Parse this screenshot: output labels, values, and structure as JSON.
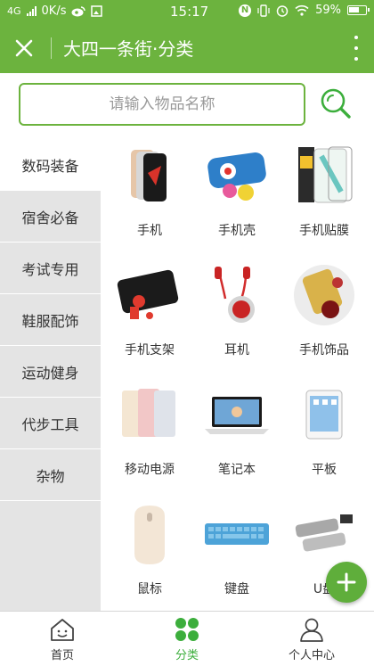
{
  "status_bar": {
    "network": "4G",
    "speed": "0K/s",
    "time": "15:17",
    "battery": "59%"
  },
  "app_bar": {
    "title": "大四一条街·分类"
  },
  "search": {
    "placeholder": "请输入物品名称"
  },
  "sidebar": {
    "items": [
      {
        "label": "数码装备",
        "active": true
      },
      {
        "label": "宿舍必备"
      },
      {
        "label": "考试专用"
      },
      {
        "label": "鞋服配饰"
      },
      {
        "label": "运动健身"
      },
      {
        "label": "代步工具"
      },
      {
        "label": "杂物"
      }
    ]
  },
  "products": [
    {
      "label": "手机",
      "icon": "phone-icon"
    },
    {
      "label": "手机壳",
      "icon": "phone-case-icon"
    },
    {
      "label": "手机贴膜",
      "icon": "screen-film-icon"
    },
    {
      "label": "手机支架",
      "icon": "phone-stand-icon"
    },
    {
      "label": "耳机",
      "icon": "earphones-icon"
    },
    {
      "label": "手机饰品",
      "icon": "phone-accessory-icon"
    },
    {
      "label": "移动电源",
      "icon": "power-bank-icon"
    },
    {
      "label": "笔记本",
      "icon": "laptop-icon"
    },
    {
      "label": "平板",
      "icon": "tablet-icon"
    },
    {
      "label": "鼠标",
      "icon": "mouse-icon"
    },
    {
      "label": "键盘",
      "icon": "keyboard-icon"
    },
    {
      "label": "U盘",
      "icon": "usb-drive-icon"
    }
  ],
  "tab_bar": {
    "home": "首页",
    "category": "分类",
    "profile": "个人中心"
  },
  "colors": {
    "brand": "#6cb33e",
    "active_tab": "#3cae3c"
  }
}
